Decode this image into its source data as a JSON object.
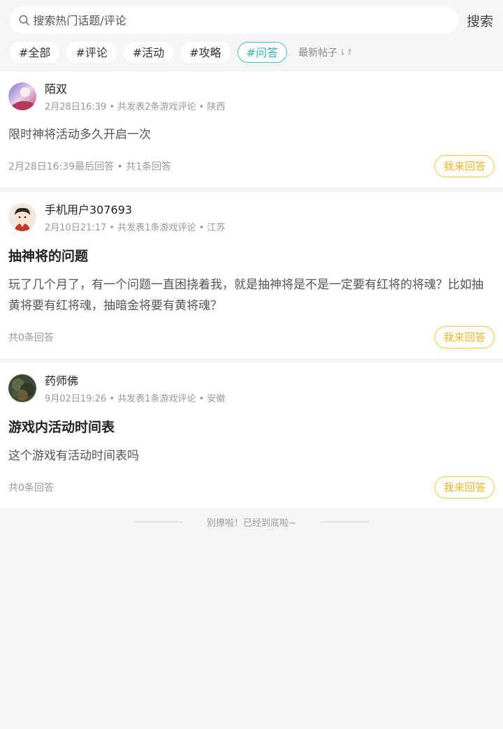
{
  "search": {
    "placeholder": "搜索热门话题/评论",
    "button_label": "搜索"
  },
  "tags": [
    {
      "label": "#全部",
      "active": false
    },
    {
      "label": "#评论",
      "active": false
    },
    {
      "label": "#活动",
      "active": false
    },
    {
      "label": "#攻略",
      "active": false
    },
    {
      "label": "#问答",
      "active": true
    }
  ],
  "sort": {
    "label": "最新帖子",
    "icon": "sort-arrows-icon"
  },
  "posts": [
    {
      "username": "陌双",
      "meta": "2月28日16:39 • 共发表2条游戏评论 • 陕西",
      "title": "",
      "content": "限时神将活动多久开启一次",
      "footer": "2月28日16:39最后回答 • 共1条回答",
      "answer_label": "我来回答"
    },
    {
      "username": "手机用户307693",
      "meta": "2月10日21:17 • 共发表1条游戏评论 • 江苏",
      "title": "抽神将的问题",
      "content": "玩了几个月了，有一个问题一直困挠着我，就是抽神将是不是一定要有红将的将魂？比如抽黄将要有红将魂，抽暗金将要有黄将魂？",
      "footer": "共0条回答",
      "answer_label": "我来回答"
    },
    {
      "username": "药师佛",
      "meta": "9月02日19:26 • 共发表1条游戏评论 • 安徽",
      "title": "游戏内活动时间表",
      "content": "这个游戏有活动时间表吗",
      "footer": "共0条回答",
      "answer_label": "我来回答"
    }
  ],
  "end_text": "别撩啦！已经到底啦~",
  "colors": {
    "accent": "#3aa9b3",
    "answer": "#f0b429",
    "background": "#f4f5f7"
  }
}
